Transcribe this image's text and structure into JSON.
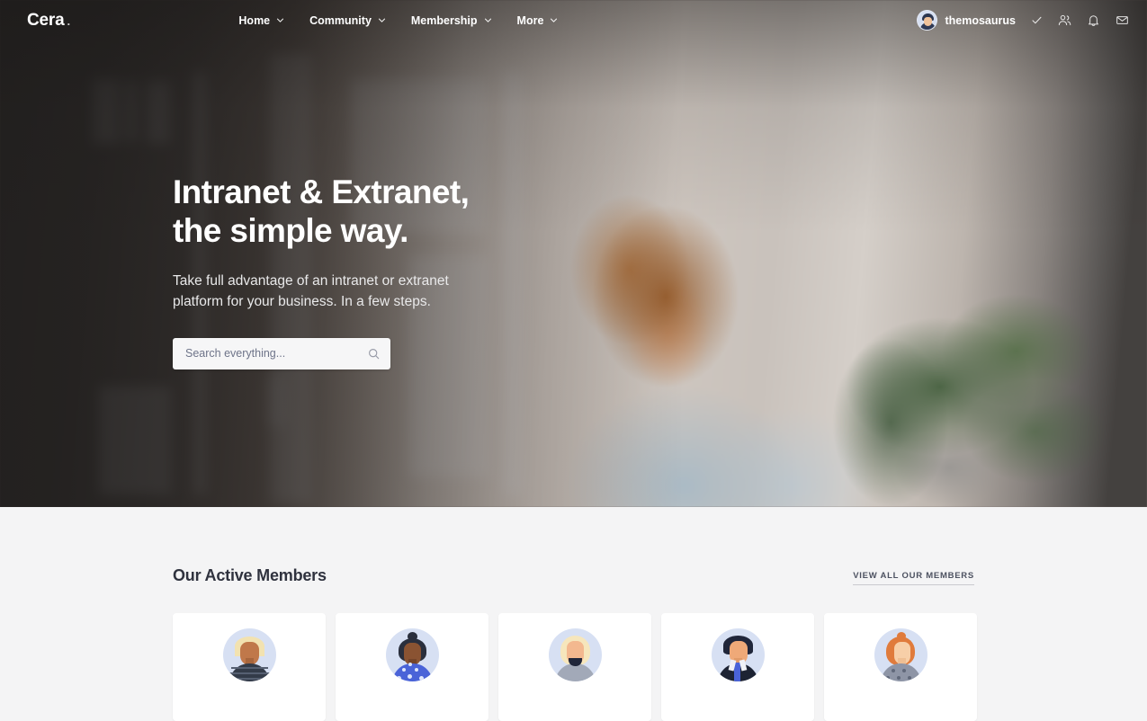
{
  "brand": {
    "name": "Cera",
    "dot": "."
  },
  "nav": {
    "items": [
      {
        "label": "Home",
        "icon": "chevron-down-icon"
      },
      {
        "label": "Community",
        "icon": "chevron-down-icon"
      },
      {
        "label": "Membership",
        "icon": "chevron-down-icon"
      },
      {
        "label": "More",
        "icon": "chevron-down-icon"
      }
    ],
    "user": {
      "name": "themosaurus",
      "avatar": "user-avatar"
    },
    "icons": [
      {
        "name": "check-icon"
      },
      {
        "name": "members-icon"
      },
      {
        "name": "notifications-bell-icon"
      },
      {
        "name": "mail-envelope-icon"
      }
    ]
  },
  "hero": {
    "title": "Intranet & Extranet,\nthe simple way.",
    "subtitle": "Take full advantage of an intranet or extranet\nplatform for your business. In a few steps.",
    "search": {
      "placeholder": "Search everything...",
      "value": "",
      "icon": "search-icon"
    }
  },
  "members_section": {
    "title": "Our Active Members",
    "view_all_label": "VIEW ALL OUR MEMBERS",
    "cards": [
      {
        "name": "member-card-1",
        "avatar": "blond-man-striped-shirt-avatar",
        "hair": "#f2e2b0",
        "skin": "#c0784a",
        "body": "#333b49",
        "bg": "#d7e0f3"
      },
      {
        "name": "member-card-2",
        "avatar": "dark-haired-woman-bun-polkadot-avatar",
        "hair": "#2a2f3d",
        "skin": "#8a5332",
        "body": "#4a63d8",
        "bg": "#d7e0f3"
      },
      {
        "name": "member-card-3",
        "avatar": "blonde-woman-grey-top-avatar",
        "hair": "#f6e6bc",
        "skin": "#f3b88f",
        "body": "#a2a9b8",
        "bg": "#d7e0f3"
      },
      {
        "name": "member-card-4",
        "avatar": "dark-haired-man-suit-tie-avatar",
        "hair": "#20263a",
        "skin": "#efa978",
        "body": "#1d2333",
        "bg": "#d7e0f3"
      },
      {
        "name": "member-card-5",
        "avatar": "red-haired-woman-dotted-top-avatar",
        "hair": "#e07b3c",
        "skin": "#f7cfa8",
        "body": "#8e95a6",
        "bg": "#d7e0f3"
      }
    ]
  },
  "colors": {
    "page_bg": "#f4f4f5",
    "card_bg": "#ffffff",
    "text_dark": "#2f323e",
    "nav_text": "#ffffff",
    "avatar_bg": "#d7e0f3"
  }
}
